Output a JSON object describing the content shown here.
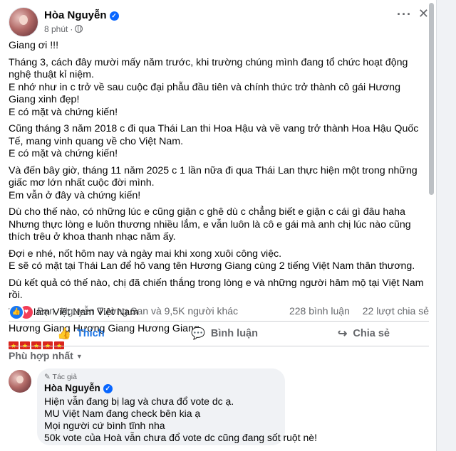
{
  "post": {
    "author": "Hòa Nguyễn",
    "time": "8 phút",
    "paragraphs": [
      [
        "Giang ơi !!!"
      ],
      [
        "Tháng 3, cách đây mười mấy năm trước, khi trường chúng mình đang tổ chức hoạt động nghệ thuật kỉ niệm.",
        "E nhớ như in c trở về sau cuộc đại phẫu đầu tiên và chính thức trở thành cô gái Hương Giang xinh đẹp!",
        "E có mặt và chứng kiến!"
      ],
      [
        "Cũng tháng 3 năm 2018 c đi qua Thái Lan thi Hoa Hậu và về vang trở thành Hoa Hậu Quốc Tế, mang vinh quang về cho Việt Nam.",
        "E có mặt và chứng kiến!"
      ],
      [
        "Và đến bây giờ, tháng 11 năm 2025 c 1 lần nữa đi qua Thái Lan thực hiện một trong những giấc mơ lớn nhất cuộc đời mình.",
        "Em vẫn ở đây và chứng kiến!"
      ],
      [
        "Dù cho thế nào, có những lúc e cũng giận c ghê dù c chẳng biết e giận c cái gì đâu haha",
        "Nhưng thực lòng e luôn thương nhiều lắm, e vẫn luôn là cô e gái mà anh chị lúc nào cũng thích trêu ở khoa thanh nhạc năm ấy."
      ],
      [
        "Đợi e nhé, nốt hôm nay và ngày mai khi xong xuôi công việc.",
        "E sẽ có mặt tại Thái Lan để hô vang tên Hương Giang cùng 2 tiếng Việt Nam thân thương."
      ],
      [
        "Dù kết quả có thế nào, chị đã chiến thắng trong lòng e và những người hâm mộ tại Việt Nam rồi."
      ],
      [
        "Việt Nam Việt Nam Việt Nam"
      ],
      [
        "Hương Giang Hương Giang Hương Giang"
      ]
    ],
    "flag_count": 5
  },
  "reactions": {
    "summary": "Bạn, Nguyễn Tường San và 9,5K người khác",
    "comments": "228 bình luận",
    "shares": "22 lượt chia sẻ"
  },
  "actions": {
    "like": "Thích",
    "comment": "Bình luận",
    "share": "Chia sẻ"
  },
  "filter": {
    "label": "Phù hợp nhất"
  },
  "comment": {
    "badge": "Tác giả",
    "author": "Hòa Nguyễn",
    "lines": [
      "Hiện vẫn đang bị lag và chưa đổ vote dc ạ.",
      "MU Việt Nam đang check bên kia ạ",
      "Mọi người cứ bình tĩnh nha",
      "50k vote của Hoà vẫn chưa đổ vote dc cũng đang sốt ruột nè!"
    ]
  },
  "colors": {
    "accent": "#1b74e4",
    "verified": "#0866ff",
    "love": "#f33e58",
    "flag_red": "#da251d",
    "flag_star": "#ffdd00"
  }
}
